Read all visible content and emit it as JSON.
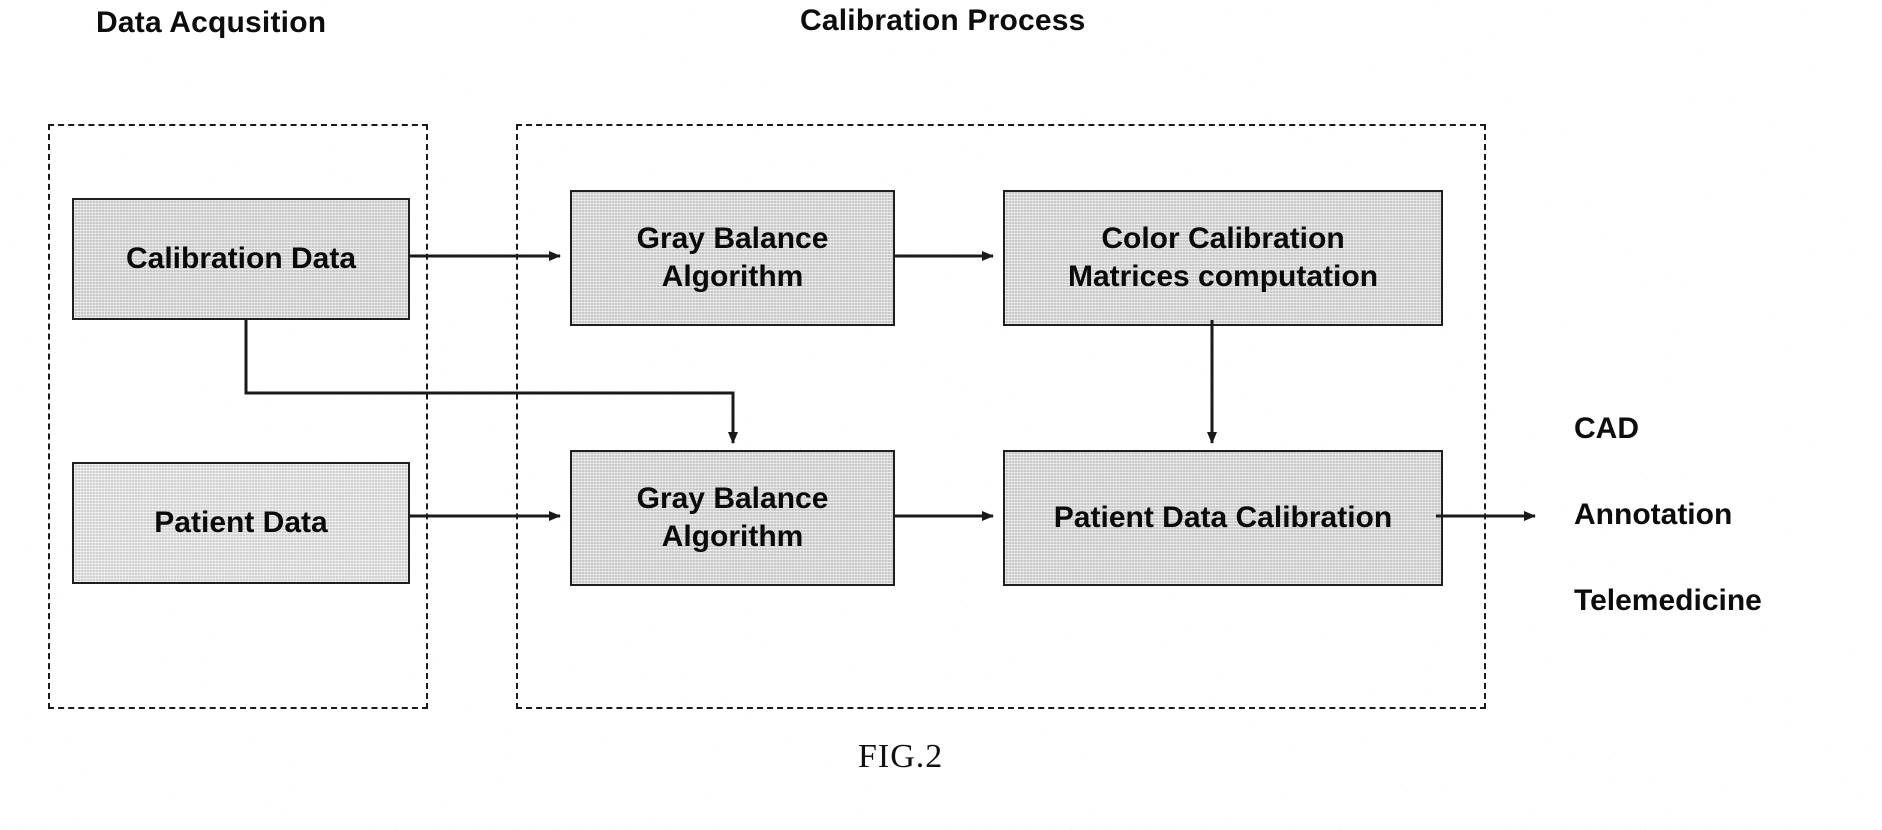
{
  "figure": {
    "caption": "FIG.2"
  },
  "groups": [
    {
      "id": "data-acquisition",
      "title": "Data Acqusition"
    },
    {
      "id": "calibration-process",
      "title": "Calibration Process"
    }
  ],
  "boxes": [
    {
      "id": "calibration-data",
      "line1": "Calibration Data",
      "line2": ""
    },
    {
      "id": "gray-balance-top",
      "line1": "Gray Balance",
      "line2": "Algorithm"
    },
    {
      "id": "color-calibration",
      "line1": "Color Calibration",
      "line2": "Matrices computation"
    },
    {
      "id": "patient-data",
      "line1": "Patient Data",
      "line2": ""
    },
    {
      "id": "gray-balance-bottom",
      "line1": "Gray Balance",
      "line2": "Algorithm"
    },
    {
      "id": "patient-data-calibration",
      "line1": "Patient Data Calibration",
      "line2": ""
    }
  ],
  "outputs": [
    {
      "id": "cad",
      "label": "CAD"
    },
    {
      "id": "annotation",
      "label": "Annotation"
    },
    {
      "id": "telemedicine",
      "label": "Telemedicine"
    }
  ],
  "colors": {
    "box_fill": "#c9c9c9",
    "box_border": "#1f1f1f",
    "line": "#1a1a1a",
    "text": "#0d0d0d",
    "background": "#ffffff"
  },
  "connections": [
    {
      "id": "calibration-data-to-gray-balance-top",
      "kind": "arrow-right"
    },
    {
      "id": "gray-balance-top-to-color-calibration",
      "kind": "arrow-right"
    },
    {
      "id": "calibration-data-to-gray-balance-bottom",
      "kind": "arrow-elbow-down"
    },
    {
      "id": "patient-data-to-gray-balance-bottom",
      "kind": "arrow-right"
    },
    {
      "id": "gray-balance-bottom-to-patient-data-calibration",
      "kind": "arrow-right"
    },
    {
      "id": "color-calibration-to-patient-data-calibration",
      "kind": "arrow-down"
    },
    {
      "id": "patient-data-calibration-to-outputs",
      "kind": "arrow-right"
    }
  ]
}
